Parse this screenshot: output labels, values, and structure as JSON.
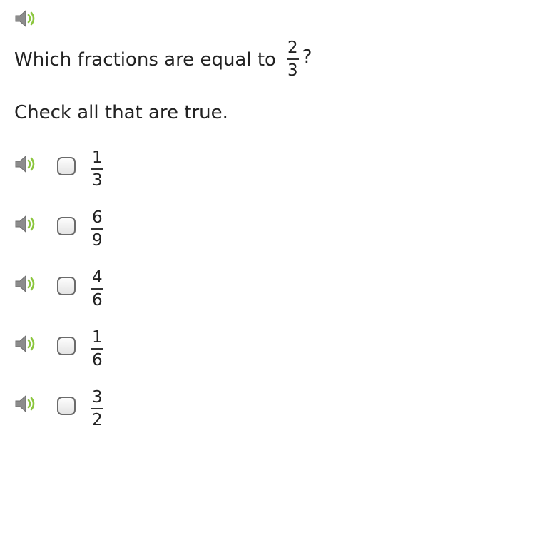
{
  "question": {
    "text": "Which fractions are equal to",
    "fraction": {
      "numerator": "2",
      "denominator": "3"
    },
    "suffix": "?"
  },
  "instruction": "Check all that are true.",
  "icons": {
    "speaker": "speaker-icon",
    "speaker_color": "#808080",
    "wave_color": "#8cc63f"
  },
  "options": [
    {
      "numerator": "1",
      "denominator": "3",
      "checked": false
    },
    {
      "numerator": "6",
      "denominator": "9",
      "checked": false
    },
    {
      "numerator": "4",
      "denominator": "6",
      "checked": false
    },
    {
      "numerator": "1",
      "denominator": "6",
      "checked": false
    },
    {
      "numerator": "3",
      "denominator": "2",
      "checked": false
    }
  ]
}
